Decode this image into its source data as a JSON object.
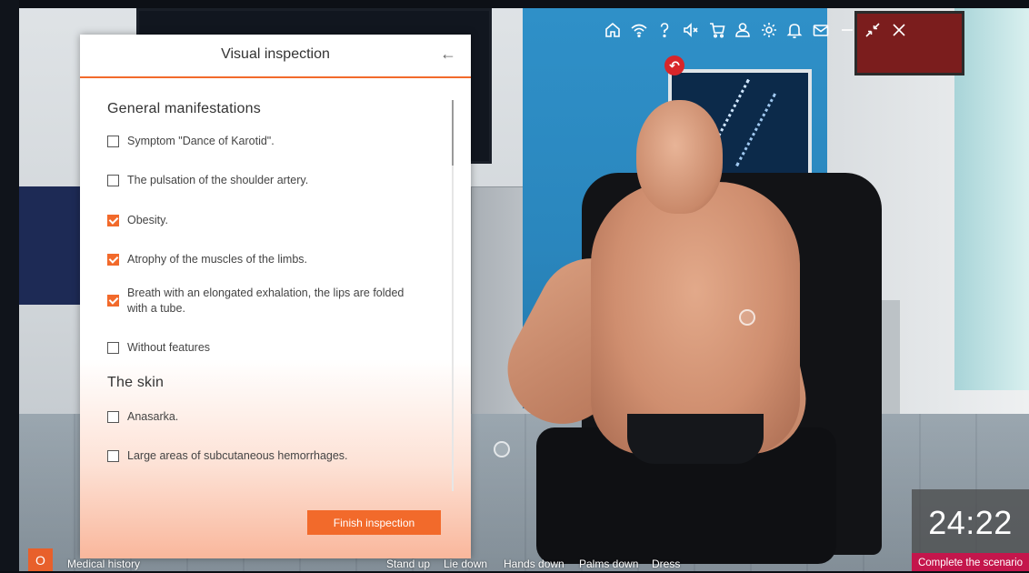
{
  "panel": {
    "title": "Visual inspection",
    "back_icon": "arrow-left-icon",
    "sections": [
      {
        "title": "General manifestations",
        "items": [
          {
            "label": "Symptom \"Dance of Karotid\".",
            "checked": false
          },
          {
            "label": "The pulsation of the shoulder artery.",
            "checked": false
          },
          {
            "label": "Obesity.",
            "checked": true
          },
          {
            "label": "Atrophy of the muscles of the limbs.",
            "checked": true
          },
          {
            "label": "Breath with an elongated exhalation, the lips are folded with a tube.",
            "checked": true
          },
          {
            "label": "Without features",
            "checked": false
          }
        ]
      },
      {
        "title": "The skin",
        "items": [
          {
            "label": "Anasarka.",
            "checked": false
          },
          {
            "label": "Large areas of subcutaneous hemorrhages.",
            "checked": false
          }
        ]
      }
    ],
    "finish_label": "Finish inspection"
  },
  "toolbar": {
    "icons": [
      "home-icon",
      "wifi-icon",
      "help-icon",
      "mute-icon",
      "cart-icon",
      "user-icon",
      "settings-icon",
      "bell-icon",
      "mail-icon",
      "minimize-icon",
      "shrink-icon",
      "close-icon"
    ]
  },
  "bottom_bar": {
    "history_icon_glyph": "O",
    "medical_history": "Medical history",
    "actions": [
      "Stand up",
      "Lie down",
      "Hands down",
      "Palms down",
      "Dress"
    ]
  },
  "timer": {
    "value": "24:22",
    "complete_label": "Complete the scenario"
  },
  "colors": {
    "accent": "#f26a2b",
    "complete": "#c4164c"
  }
}
